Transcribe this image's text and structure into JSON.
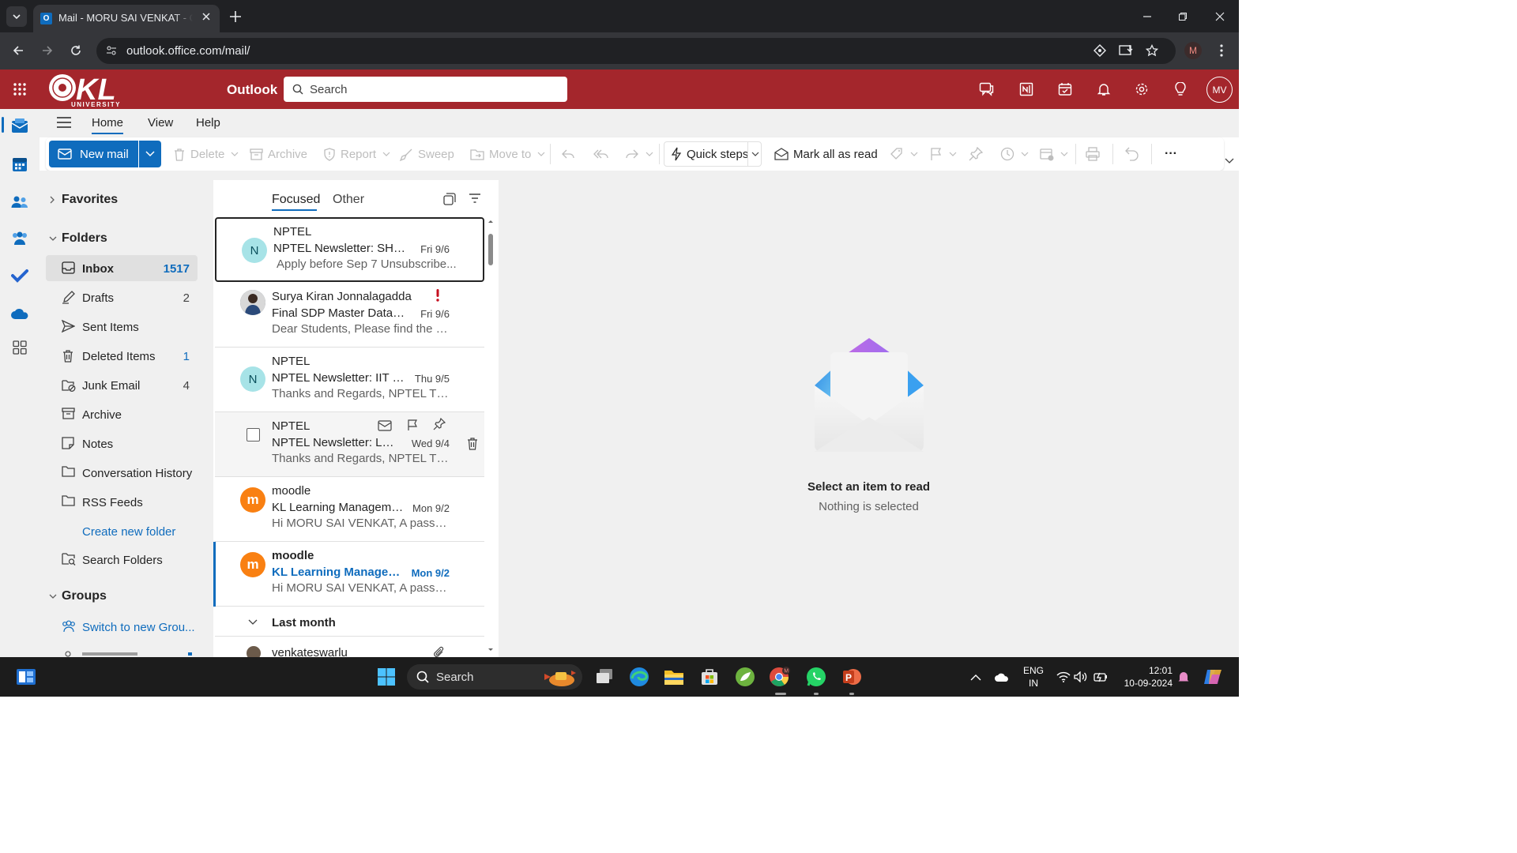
{
  "browser": {
    "tab_title": "Mail - MORU SAI VENKAT - Outlook",
    "url": "outlook.office.com/mail/",
    "profile_initial": "M"
  },
  "header": {
    "app_title": "Outlook",
    "search_placeholder": "Search",
    "user_initials": "MV",
    "brand_color": "#a4262c",
    "logo_text": "KL UNIVERSITY"
  },
  "ribbon": {
    "tabs": [
      "Home",
      "View",
      "Help"
    ],
    "new_mail": "New mail",
    "delete": "Delete",
    "archive": "Archive",
    "report": "Report",
    "sweep": "Sweep",
    "move_to": "Move to",
    "quick_steps": "Quick steps",
    "mark_all_read": "Mark all as read",
    "more": "···"
  },
  "folders": {
    "favorites": "Favorites",
    "folders_header": "Folders",
    "items": [
      {
        "label": "Inbox",
        "count": "1517"
      },
      {
        "label": "Drafts",
        "count": "2"
      },
      {
        "label": "Sent Items",
        "count": ""
      },
      {
        "label": "Deleted Items",
        "count": "1"
      },
      {
        "label": "Junk Email",
        "count": "4"
      },
      {
        "label": "Archive",
        "count": ""
      },
      {
        "label": "Notes",
        "count": ""
      },
      {
        "label": "Conversation History",
        "count": ""
      },
      {
        "label": "RSS Feeds",
        "count": ""
      }
    ],
    "create_new": "Create new folder",
    "search_folders": "Search Folders",
    "groups_header": "Groups",
    "switch_groups": "Switch to new Grou..."
  },
  "message_list": {
    "tab_focused": "Focused",
    "tab_other": "Other",
    "messages": [
      {
        "sender": "NPTEL",
        "subject": "NPTEL Newsletter: SHAA...",
        "date": "Fri 9/6",
        "preview": "Apply before Sep 7  Unsubscribe...",
        "avatar": "N"
      },
      {
        "sender": "Surya Kiran Jonnalagadda",
        "subject": "Final SDP Master Data, Pl...",
        "date": "Fri 9/6",
        "preview": "Dear Students, Please find the SD...",
        "avatar": ""
      },
      {
        "sender": "NPTEL",
        "subject": "NPTEL Newsletter: IIT M...",
        "date": "Thu 9/5",
        "preview": "Thanks and Regards, NPTEL TEA...",
        "avatar": "N"
      },
      {
        "sender": "NPTEL",
        "subject": "NPTEL Newsletter: Lear...",
        "date": "Wed 9/4",
        "preview": "Thanks and Regards, NPTEL TEA...",
        "avatar": ""
      },
      {
        "sender": "moodle",
        "subject": "KL Learning Manageme...",
        "date": "Mon 9/2",
        "preview": "Hi MORU SAI VENKAT, A passwor...",
        "avatar": "m"
      },
      {
        "sender": "moodle",
        "subject": "KL Learning Managem...",
        "date": "Mon 9/2",
        "preview": "Hi MORU SAI VENKAT, A passwor...",
        "avatar": "m"
      }
    ],
    "group_last_month": "Last month",
    "partial_sender": "venkateswarlu"
  },
  "reading_pane": {
    "title": "Select an item to read",
    "subtitle": "Nothing is selected"
  },
  "taskbar": {
    "search_placeholder": "Search",
    "lang_top": "ENG",
    "lang_bottom": "IN",
    "time": "12:01",
    "date": "10-09-2024"
  }
}
